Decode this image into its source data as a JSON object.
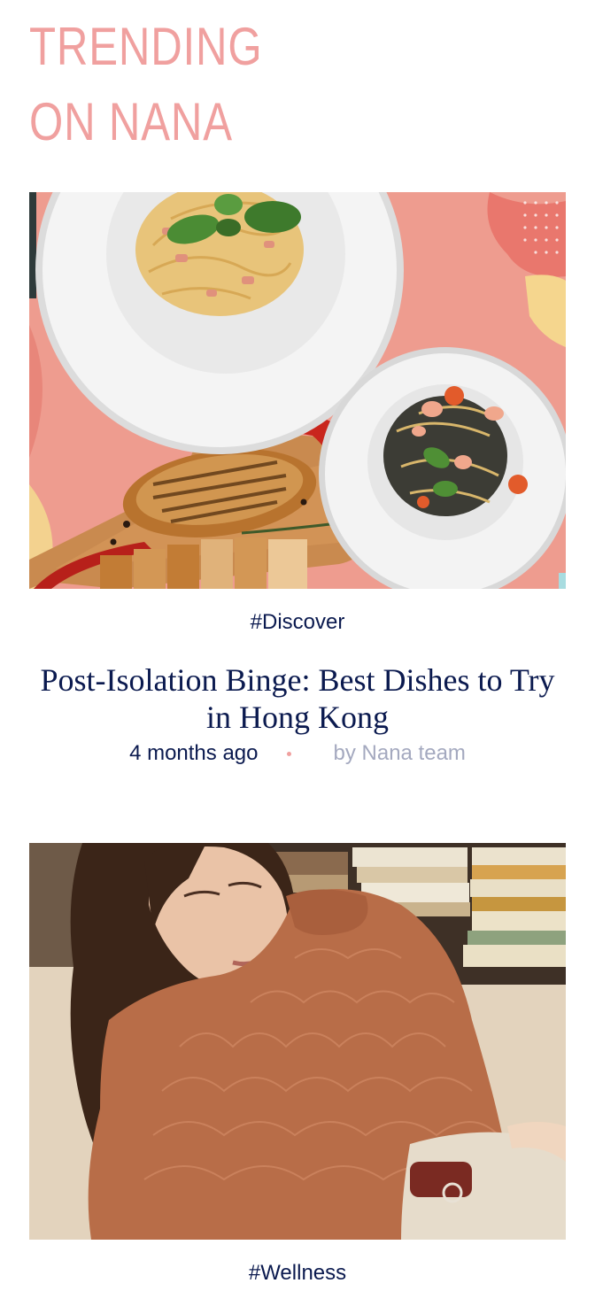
{
  "section": {
    "title": "TRENDING ON NANA"
  },
  "articles": [
    {
      "tag": "#Discover",
      "title": "Post-Isolation Binge: Best Dishes to Try in Hong Kong",
      "time": "4 months ago",
      "author": "by Nana team",
      "image_subject": "food-photo"
    },
    {
      "tag": "#Wellness",
      "image_subject": "woman-in-knit-sweater-photo"
    }
  ],
  "colors": {
    "accent": "#f0a09f",
    "navy": "#0b1a4f",
    "muted": "#a4a9bf"
  }
}
